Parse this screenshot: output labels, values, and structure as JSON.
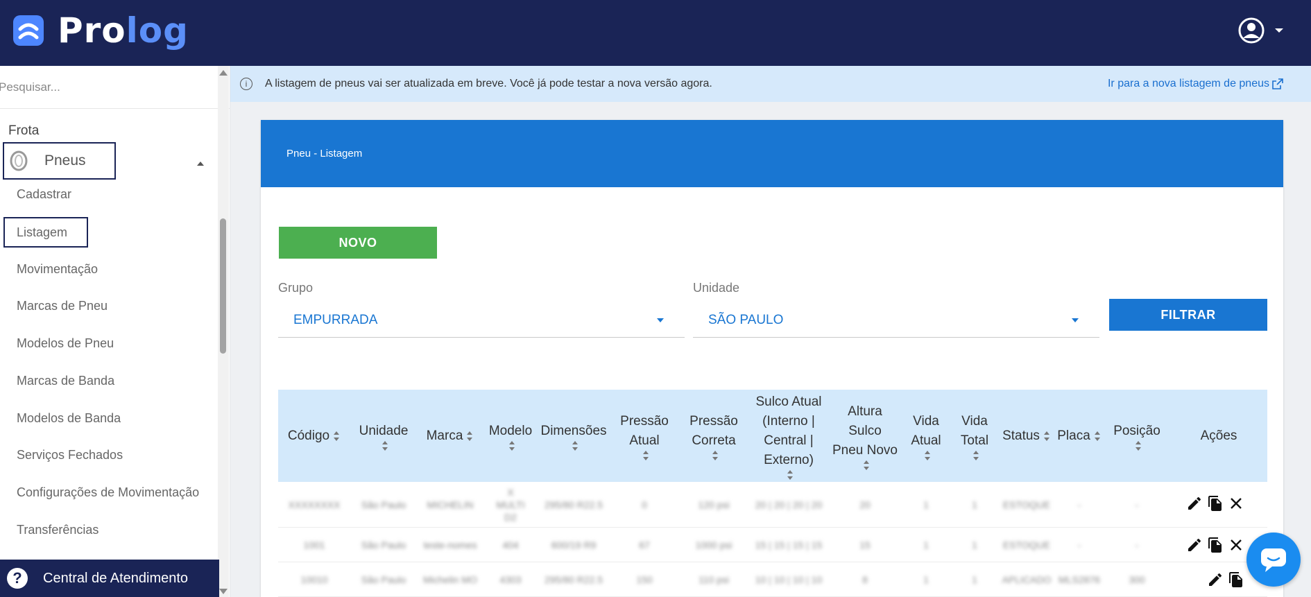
{
  "app": {
    "logo": {
      "part1": "Pro",
      "part2": "log"
    },
    "colors": {
      "topbar": "#1a2456",
      "primary": "#1976d2",
      "success": "#4caf50",
      "banner": "#d6e9fb"
    }
  },
  "sidebar": {
    "search_placeholder": "Pesquisar...",
    "section": "Frota",
    "group_label": "Pneus",
    "items": [
      {
        "label": "Cadastrar"
      },
      {
        "label": "Listagem",
        "active": true
      },
      {
        "label": "Movimentação"
      },
      {
        "label": "Marcas de Pneu"
      },
      {
        "label": "Modelos de Pneu"
      },
      {
        "label": "Marcas de Banda"
      },
      {
        "label": "Modelos de Banda"
      },
      {
        "label": "Serviços Fechados"
      },
      {
        "label": "Configurações de Movimentação"
      },
      {
        "label": "Transferências"
      }
    ],
    "help_label": "Central de Atendimento"
  },
  "banner": {
    "message": "A listagem de pneus vai ser atualizada em breve. Você já pode testar a nova versão agora.",
    "link": "Ir para a nova listagem de pneus"
  },
  "card": {
    "title": "Pneu - Listagem",
    "new_button": "NOVO",
    "group_label": "Grupo",
    "group_value": "EMPURRADA",
    "unit_label": "Unidade",
    "unit_value": "SÃO PAULO",
    "filter_button": "FILTRAR"
  },
  "table": {
    "headers": [
      "Código",
      "Unidade",
      "Marca",
      "Modelo",
      "Dimensões",
      "Pressão Atual",
      "Pressão Correta",
      "Sulco Atual (Interno | Central | Externo)",
      "Altura Sulco Pneu Novo",
      "Vida Atual",
      "Vida Total",
      "Status",
      "Placa",
      "Posição",
      "Ações"
    ],
    "rows": [
      [
        "XXXXXXXX",
        "São Paulo",
        "MICHELIN",
        "X MULTI D2",
        "295/80 R22.5",
        "0",
        "120 psi",
        "20 | 20 | 20 | 20",
        "20",
        "1",
        "1",
        "ESTOQUE",
        "-",
        "-"
      ],
      [
        "1001",
        "São Paulo",
        "teste-nomes",
        "404",
        "600/19 R9",
        "67",
        "1000 psi",
        "15 | 15 | 15 | 15",
        "15",
        "1",
        "1",
        "ESTOQUE",
        "-",
        "-"
      ],
      [
        "10010",
        "São Paulo",
        "Michelin MO",
        "4303",
        "295/80 R22.5",
        "150",
        "110 psi",
        "10 | 10 | 10 | 10",
        "8",
        "1",
        "1",
        "APLICADO",
        "MLS2876",
        "300"
      ]
    ]
  }
}
